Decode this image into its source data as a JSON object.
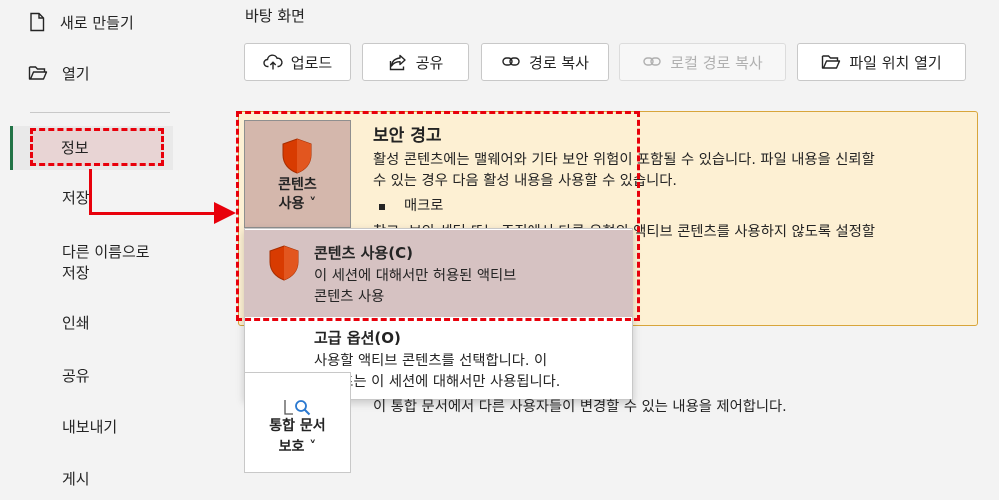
{
  "sidebar": {
    "new_label": "새로 만들기",
    "open_label": "열기",
    "info_label": "정보",
    "save_label": "저장",
    "save_as_line1": "다른 이름으로",
    "save_as_line2": "저장",
    "print_label": "인쇄",
    "share_label": "공유",
    "export_label": "내보내기",
    "publish_label": "게시"
  },
  "location": "바탕 화면",
  "toolbar": {
    "upload": "업로드",
    "share": "공유",
    "copy_path": "경로 복사",
    "copy_local_path": "로컬 경로 복사",
    "open_location": "파일 위치 열기"
  },
  "security": {
    "tile_line1": "콘텐츠",
    "tile_line2": "사용 ˅",
    "title": "보안 경고",
    "text_line1": "활성 콘텐츠에는 맬웨어와 기타 보안 위험이 포함될 수 있습니다. 파일 내용을 신뢰할",
    "text_line2": "수 있는 경우 다음 활성 내용을 사용할 수 있습니다.",
    "bullet_item": "매크로",
    "text_line4": "참고: 보안 센터 또는 조직에서 다른 유형의 액티브 콘텐츠를 사용하지 않도록 설정할"
  },
  "dropdown": {
    "item1_title": "콘텐츠 사용(C)",
    "item1_desc_line1": "이 세션에 대해서만 허용된 액티브",
    "item1_desc_line2": "콘텐츠 사용",
    "item2_title": "고급 옵션(O)",
    "item2_desc_line1": "사용할 액티브 콘텐츠를 선택합니다. 이",
    "item2_desc_line2": "콘텐츠는 이 세션에 대해서만 사용됩니다."
  },
  "integrated": {
    "tile_line1": "통합 문서",
    "tile_line2": "보호 ˅",
    "desc": "이 통합 문서에서 다른 사용자들이 변경할 수 있는 내용을 제어합니다."
  },
  "colors": {
    "accent_green": "#217346",
    "highlight_red": "#e8000b",
    "warning_bg": "#fdf0d3",
    "shield_orange": "#d83b01"
  }
}
